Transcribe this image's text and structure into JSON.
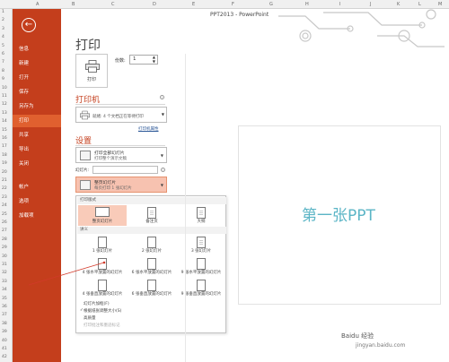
{
  "app_title": "PPT2013 - PowerPoint",
  "columns": [
    "A",
    "B",
    "C",
    "D",
    "E",
    "F",
    "G",
    "H",
    "I",
    "J",
    "K",
    "L",
    "M"
  ],
  "rows": [
    "1",
    "2",
    "3",
    "4",
    "5",
    "6",
    "7",
    "8",
    "9",
    "10",
    "11",
    "12",
    "13",
    "14",
    "15",
    "16",
    "17",
    "18",
    "19",
    "20",
    "21",
    "22",
    "23",
    "24",
    "25",
    "26",
    "27",
    "28",
    "29",
    "30",
    "31",
    "32",
    "33",
    "34",
    "35",
    "36",
    "37",
    "38",
    "39",
    "40",
    "41",
    "42"
  ],
  "sidebar": {
    "back_icon": "back-arrow-icon",
    "items": [
      "信息",
      "新建",
      "打开",
      "保存",
      "另存为",
      "打印",
      "共享",
      "导出",
      "关闭",
      "帐户",
      "选项",
      "加载项"
    ],
    "active": "打印",
    "accent_color": "#c43e1c"
  },
  "page_title": "打印",
  "print_button": {
    "label": "打印"
  },
  "copies": {
    "label": "份数:",
    "value": "1"
  },
  "printer_section": {
    "title": "打印机",
    "status": "就绪: 4 个文档正在等待打印",
    "properties_link": "打印机属性"
  },
  "settings_section": {
    "title": "设置",
    "range": {
      "line1": "打印全部幻灯片",
      "line2": "打印整个演示文稿"
    },
    "slides_label": "幻灯片:",
    "layout": {
      "line1": "整页幻灯片",
      "line2": "每页打印 1 张幻灯片"
    }
  },
  "dropdown": {
    "section1": "打印版式",
    "layouts": [
      "整页幻灯片",
      "备注页",
      "大纲"
    ],
    "section2": "讲义",
    "handouts_row1": [
      "1 张幻灯片",
      "2 张幻灯片",
      "3 张幻灯片"
    ],
    "handouts_row2": [
      "4 张水平放置的幻灯片",
      "6 张水平放置的幻灯片",
      "9 张水平放置的幻灯片"
    ],
    "handouts_row3": [
      "4 张垂直放置的幻灯片",
      "6 张垂直放置的幻灯片",
      "9 张垂直放置的幻灯片"
    ],
    "options": [
      "幻灯片加框(F)",
      "根据纸张调整大小(S)",
      "高质量",
      "打印批注和墨迹标记"
    ]
  },
  "preview": {
    "slide_text": "第一张PPT",
    "text_color": "#5bb5c6"
  },
  "watermark": {
    "line1": "Baidu 经验",
    "line2": "jingyan.baidu.com"
  }
}
